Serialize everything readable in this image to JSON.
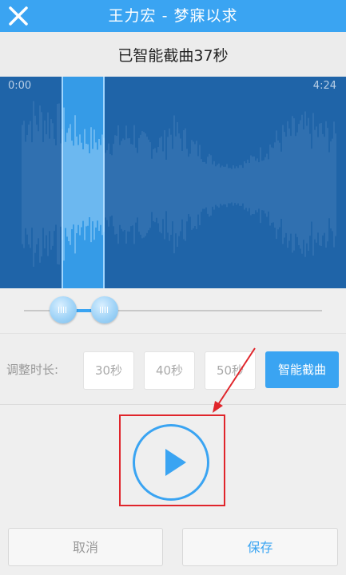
{
  "header": {
    "title": "王力宏 - 梦寐以求",
    "close_icon": "close-icon",
    "background_color": "#3aa4f2"
  },
  "status": {
    "message": "已智能截曲37秒"
  },
  "waveform": {
    "start_time": "0:00",
    "end_time": "4:24",
    "background_color": "#1f64a8",
    "selection_color": "#3aa4f2"
  },
  "duration": {
    "label": "调整时长:",
    "options": [
      "30秒",
      "40秒",
      "50秒"
    ],
    "smart_button": "智能截曲"
  },
  "player": {
    "play_icon": "play-icon",
    "highlight_color": "#e0252b"
  },
  "actions": {
    "cancel": "取消",
    "save": "保存"
  }
}
